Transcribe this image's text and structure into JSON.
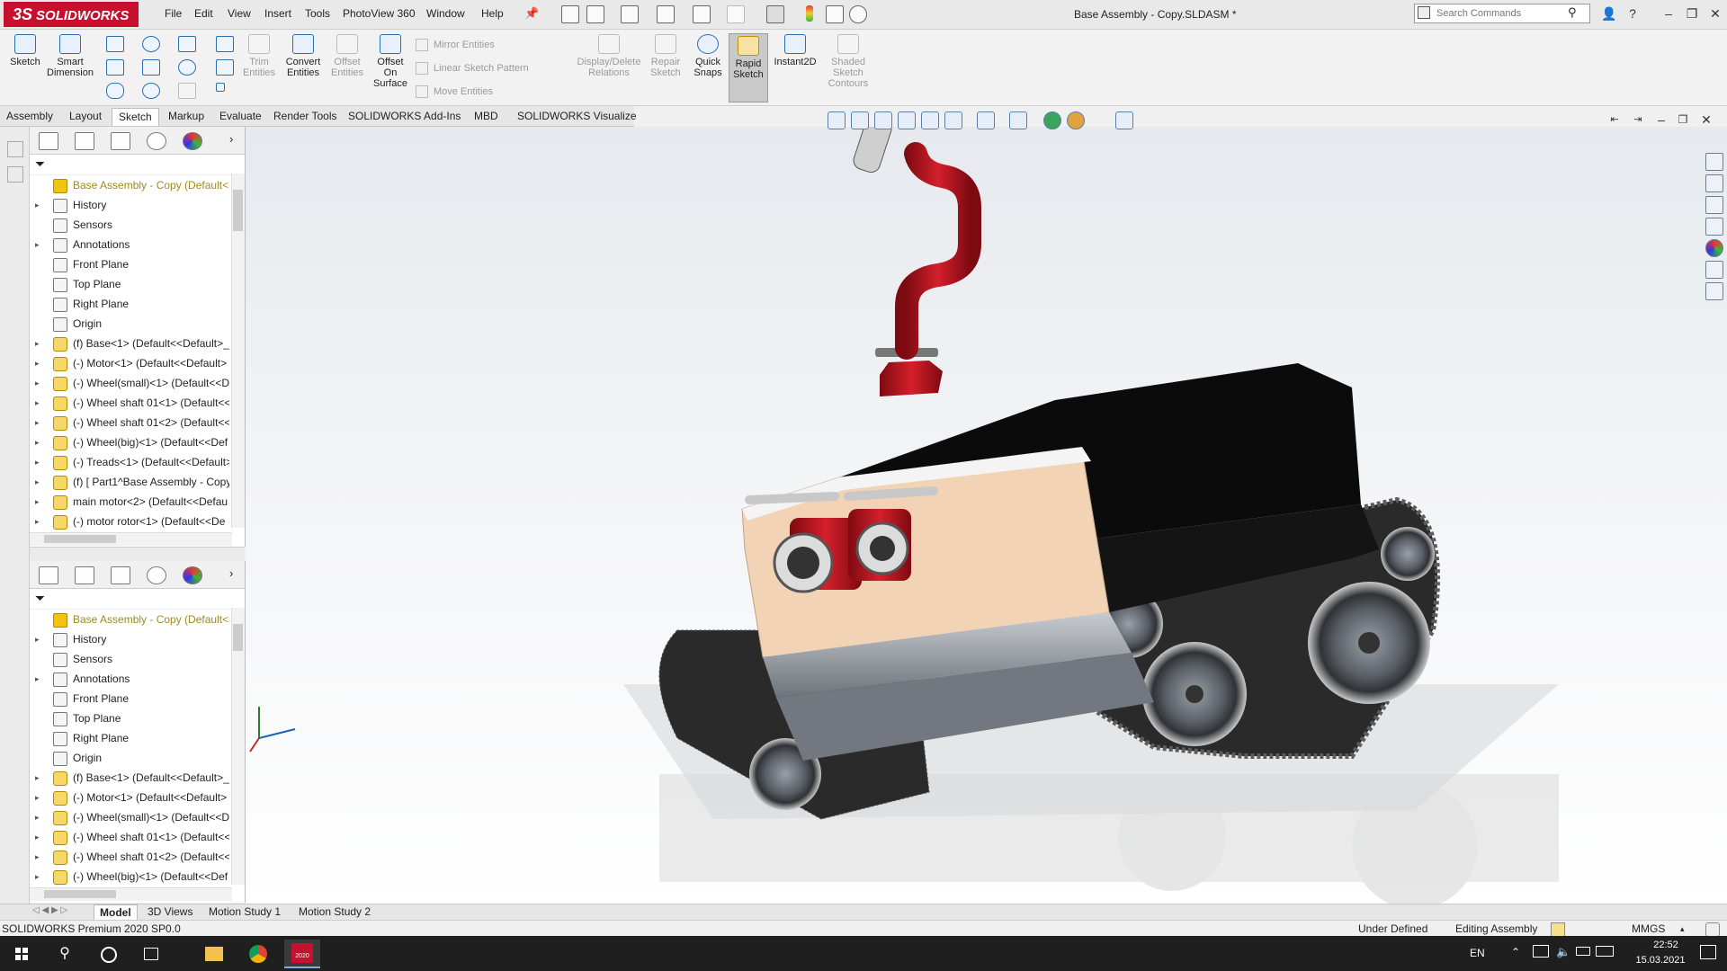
{
  "titlebar": {
    "brand": "SOLIDWORKS",
    "brand_glyph": "3S",
    "menu": [
      "File",
      "Edit",
      "View",
      "Insert",
      "Tools",
      "PhotoView 360",
      "Window",
      "Help"
    ],
    "document_title": "Base Assembly - Copy.SLDASM *",
    "search_placeholder": "Search Commands"
  },
  "commands": {
    "sketch": "Sketch",
    "smart_dimension": [
      "Smart",
      "Dimension"
    ],
    "trim_entities": [
      "Trim",
      "Entities"
    ],
    "convert_entities": [
      "Convert",
      "Entities"
    ],
    "offset_entities": [
      "Offset",
      "Entities"
    ],
    "offset_on_surface": [
      "Offset",
      "On",
      "Surface"
    ],
    "mirror_entities": "Mirror Entities",
    "linear_sketch_pattern": "Linear Sketch Pattern",
    "move_entities": "Move Entities",
    "display_delete_relations": [
      "Display/Delete",
      "Relations"
    ],
    "repair_sketch": [
      "Repair",
      "Sketch"
    ],
    "quick_snaps": [
      "Quick",
      "Snaps"
    ],
    "rapid_sketch": [
      "Rapid",
      "Sketch"
    ],
    "instant2d": "Instant2D",
    "shaded_sketch_contours": [
      "Shaded",
      "Sketch",
      "Contours"
    ]
  },
  "tabs": [
    "Assembly",
    "Layout",
    "Sketch",
    "Markup",
    "Evaluate",
    "Render Tools",
    "SOLIDWORKS Add-Ins",
    "MBD",
    "SOLIDWORKS Visualize"
  ],
  "selected_tab": "Sketch",
  "feature_tree_top": [
    {
      "label": "Base Assembly - Copy  (Default<<",
      "icon": "assembly-warning-icon",
      "root": true
    },
    {
      "label": "History",
      "icon": "history-icon"
    },
    {
      "label": "Sensors",
      "icon": "sensors-icon"
    },
    {
      "label": "Annotations",
      "icon": "annotations-icon"
    },
    {
      "label": "Front Plane",
      "icon": "plane-icon"
    },
    {
      "label": "Top Plane",
      "icon": "plane-icon"
    },
    {
      "label": "Right Plane",
      "icon": "plane-icon"
    },
    {
      "label": "Origin",
      "icon": "origin-icon"
    },
    {
      "label": "(f) Base<1> (Default<<Default>_",
      "icon": "part-icon"
    },
    {
      "label": "(-) Motor<1> (Default<<Default>",
      "icon": "part-icon"
    },
    {
      "label": "(-) Wheel(small)<1> (Default<<D",
      "icon": "part-icon"
    },
    {
      "label": "(-) Wheel shaft 01<1> (Default<<",
      "icon": "part-icon"
    },
    {
      "label": "(-) Wheel shaft 01<2> (Default<<",
      "icon": "part-icon"
    },
    {
      "label": "(-) Wheel(big)<1> (Default<<Def",
      "icon": "part-icon"
    },
    {
      "label": "(-) Treads<1> (Default<<Default>",
      "icon": "part-icon"
    },
    {
      "label": "(f) [ Part1^Base Assembly - Copy",
      "icon": "part-icon"
    },
    {
      "label": "main motor<2> (Default<<Defau",
      "icon": "part-icon"
    },
    {
      "label": "(-) motor rotor<1> (Default<<De",
      "icon": "part-icon"
    }
  ],
  "feature_tree_bottom": [
    {
      "label": "Base Assembly - Copy  (Default<<",
      "icon": "assembly-warning-icon",
      "root": true
    },
    {
      "label": "History",
      "icon": "history-icon"
    },
    {
      "label": "Sensors",
      "icon": "sensors-icon"
    },
    {
      "label": "Annotations",
      "icon": "annotations-icon"
    },
    {
      "label": "Front Plane",
      "icon": "plane-icon"
    },
    {
      "label": "Top Plane",
      "icon": "plane-icon"
    },
    {
      "label": "Right Plane",
      "icon": "plane-icon"
    },
    {
      "label": "Origin",
      "icon": "origin-icon"
    },
    {
      "label": "(f) Base<1> (Default<<Default>_",
      "icon": "part-icon"
    },
    {
      "label": "(-) Motor<1> (Default<<Default>",
      "icon": "part-icon"
    },
    {
      "label": "(-) Wheel(small)<1> (Default<<D",
      "icon": "part-icon"
    },
    {
      "label": "(-) Wheel shaft 01<1> (Default<<",
      "icon": "part-icon"
    },
    {
      "label": "(-) Wheel shaft 01<2> (Default<<",
      "icon": "part-icon"
    },
    {
      "label": "(-) Wheel(big)<1> (Default<<Def",
      "icon": "part-icon"
    }
  ],
  "bottom_tabs": [
    "Model",
    "3D Views",
    "Motion Study 1",
    "Motion Study 2"
  ],
  "selected_bottom_tab": "Model",
  "status": {
    "product": "SOLIDWORKS Premium 2020 SP0.0",
    "sketch_state": "Under Defined",
    "mode": "Editing Assembly",
    "units": "MMGS"
  },
  "taskbar": {
    "language": "EN",
    "time": "22:52",
    "date": "15.03.2021",
    "sw_badge": "2020"
  },
  "colors": {
    "brand_red": "#c8102e",
    "cannon_red": "#b3121d",
    "body_black": "#0b0b0b",
    "panel_peach": "#f3d3b5",
    "metal_grey": "#8a8f96",
    "warning_yellow": "#f1c40f"
  }
}
